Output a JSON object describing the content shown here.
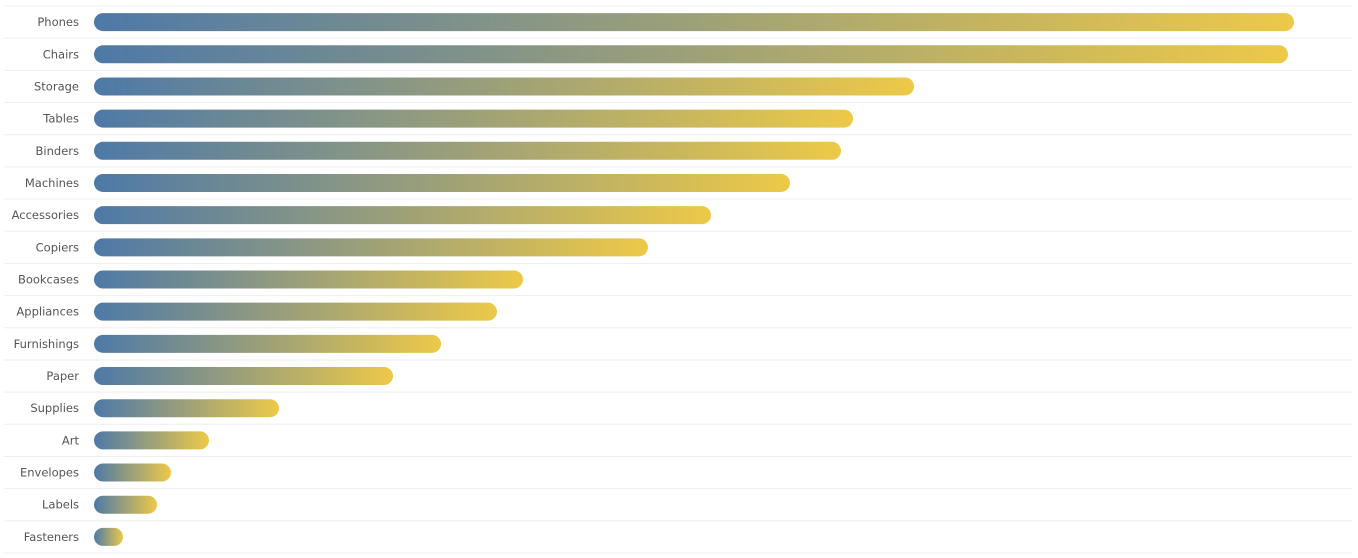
{
  "chart_data": {
    "type": "bar",
    "orientation": "horizontal",
    "title": "",
    "xlabel": "",
    "ylabel": "",
    "value_units": "relative (no axis shown; Phones = longest bar)",
    "categories": [
      "Phones",
      "Chairs",
      "Storage",
      "Tables",
      "Binders",
      "Machines",
      "Accessories",
      "Copiers",
      "Bookcases",
      "Appliances",
      "Furnishings",
      "Paper",
      "Supplies",
      "Art",
      "Envelopes",
      "Labels",
      "Fasteners"
    ],
    "values": [
      1200,
      1194,
      820,
      759,
      747,
      696,
      617,
      554,
      429,
      403,
      347,
      299,
      185,
      115,
      77,
      63,
      29
    ],
    "xlim": [
      0,
      1200
    ],
    "grid": "horizontal row separators",
    "legend": "none",
    "gradient_start_color": "#4e79a7",
    "gradient_end_color": "#edc948",
    "separator_color": "#eeeeee",
    "label_color": "#555555"
  }
}
